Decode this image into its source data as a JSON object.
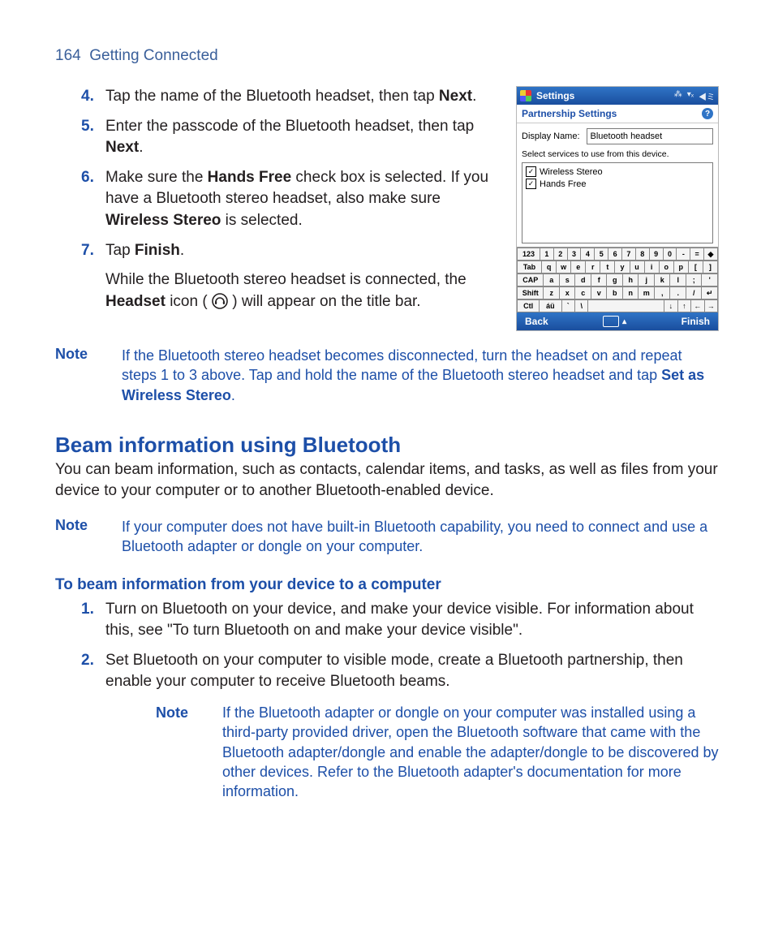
{
  "header": {
    "page_number": "164",
    "chapter": "Getting Connected"
  },
  "steps_a": [
    {
      "num": "4.",
      "parts": [
        "Tap the name of the Bluetooth headset, then tap ",
        {
          "b": "Next"
        },
        "."
      ]
    },
    {
      "num": "5.",
      "parts": [
        "Enter the passcode of the Bluetooth headset, then tap ",
        {
          "b": "Next"
        },
        "."
      ]
    },
    {
      "num": "6.",
      "parts": [
        "Make sure the ",
        {
          "b": "Hands Free"
        },
        " check box is selected. If you have a Bluetooth stereo headset, also make sure ",
        {
          "b": "Wireless Stereo"
        },
        " is selected."
      ]
    },
    {
      "num": "7.",
      "parts": [
        "Tap ",
        {
          "b": "Finish"
        },
        "."
      ],
      "after": [
        "While the Bluetooth stereo headset is connected, the ",
        {
          "b": "Headset"
        },
        " icon ( ",
        {
          "icon": "headset"
        },
        " ) will appear on the title bar."
      ]
    }
  ],
  "note1": {
    "label": "Note",
    "parts": [
      "If the Bluetooth stereo headset becomes disconnected, turn the headset on and repeat steps 1 to 3 above. Tap and hold the name of the Bluetooth stereo headset and tap ",
      {
        "b": "Set as Wireless Stereo"
      },
      "."
    ]
  },
  "section_heading": "Beam information using Bluetooth",
  "section_intro": "You can beam information, such as contacts, calendar items, and tasks, as well as files from your device to your computer or to another Bluetooth-enabled device.",
  "note2": {
    "label": "Note",
    "parts": [
      "If your computer does not have built-in Bluetooth capability, you need to connect and use a Bluetooth adapter or dongle on your computer."
    ]
  },
  "subheading": "To beam information from your device to a computer",
  "steps_b": [
    {
      "num": "1.",
      "parts": [
        "Turn on Bluetooth on your device, and make your device visible. For information about this, see \"To turn Bluetooth on and make your device visible\"."
      ]
    },
    {
      "num": "2.",
      "parts": [
        "Set Bluetooth on your computer to visible mode, create a Bluetooth partnership, then enable your computer to receive Bluetooth beams."
      ],
      "note": {
        "label": "Note",
        "parts": [
          "If the Bluetooth adapter or dongle on your computer was installed using a third-party provided driver, open the Bluetooth software that came with the Bluetooth adapter/dongle and enable the adapter/dongle to be discovered by other devices. Refer to the Bluetooth adapter's documentation for more information."
        ]
      }
    }
  ],
  "screenshot": {
    "titlebar": {
      "title": "Settings"
    },
    "subtitle": "Partnership Settings",
    "display_name_label": "Display Name:",
    "display_name_value": "Bluetooth headset",
    "instruction": "Select services to use from this device.",
    "services": [
      "Wireless Stereo",
      "Hands Free"
    ],
    "keyboard": {
      "row1": [
        "123",
        "1",
        "2",
        "3",
        "4",
        "5",
        "6",
        "7",
        "8",
        "9",
        "0",
        "-",
        "=",
        "◆"
      ],
      "row2": [
        "Tab",
        "q",
        "w",
        "e",
        "r",
        "t",
        "y",
        "u",
        "i",
        "o",
        "p",
        "[",
        "]"
      ],
      "row3": [
        "CAP",
        "a",
        "s",
        "d",
        "f",
        "g",
        "h",
        "j",
        "k",
        "l",
        ";",
        "'"
      ],
      "row4": [
        "Shift",
        "z",
        "x",
        "c",
        "v",
        "b",
        "n",
        "m",
        ",",
        ".",
        "/",
        "↵"
      ],
      "row5": [
        "Ctl",
        "áü",
        "`",
        "\\",
        " ",
        "↓",
        "↑",
        "←",
        "→"
      ]
    },
    "softkeys": {
      "left": "Back",
      "right": "Finish"
    }
  }
}
